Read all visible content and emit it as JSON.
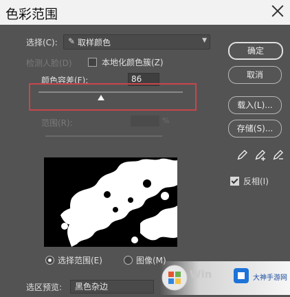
{
  "title": "色彩范围",
  "select": {
    "label": "选择(C):",
    "value": "取样颜色",
    "icon": "eyedropper-icon"
  },
  "detect_faces": {
    "label": "检测人脸(D)",
    "checked": false
  },
  "localized_clusters": {
    "label": "本地化颜色簇(Z)",
    "checked": false
  },
  "fuzziness": {
    "label": "颜色容差(F):",
    "value": "86"
  },
  "range": {
    "label": "范围(R):",
    "unit": "%"
  },
  "buttons": {
    "ok": "确定",
    "cancel": "取消",
    "load": "载入(L)...",
    "save": "存储(S)..."
  },
  "eyedroppers": [
    "eyedropper-icon",
    "eyedropper-plus-icon",
    "eyedropper-minus-icon"
  ],
  "invert": {
    "label": "反相(I)",
    "checked": true
  },
  "view_mode": {
    "selection_label": "选择范围(E)",
    "image_label": "图像(M)",
    "selected": "selection"
  },
  "selection_preview": {
    "label": "选区预览:",
    "value": "黑色杂边"
  },
  "watermark": {
    "text": "大神手游网",
    "badge": "Win"
  }
}
